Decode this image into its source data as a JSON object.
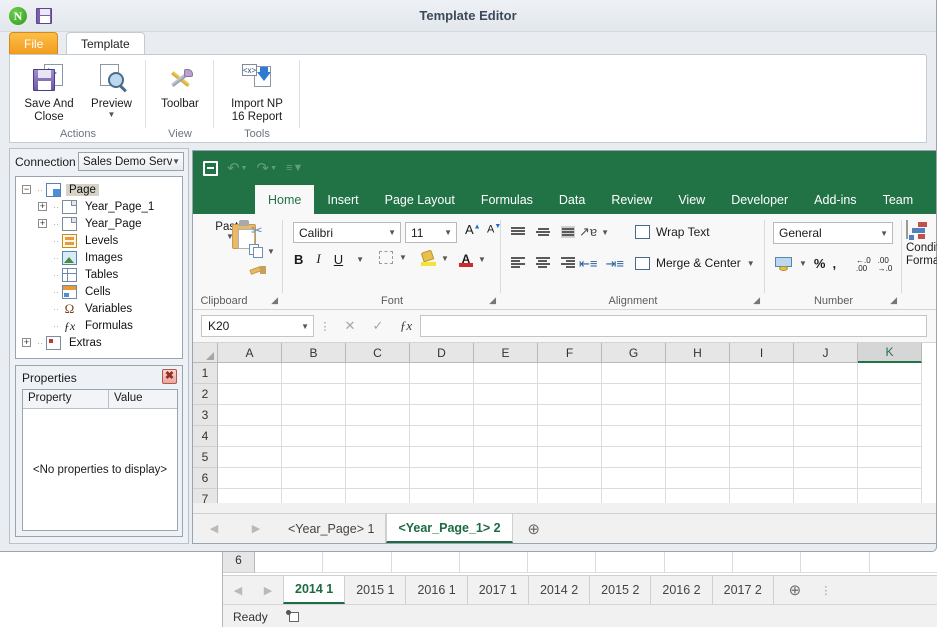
{
  "template_editor": {
    "title": "Template Editor",
    "logo_icon": "nprinting-logo-icon",
    "quick_save_icon": "save-icon",
    "tabs": [
      {
        "label": "File",
        "active": false
      },
      {
        "label": "Template",
        "active": true
      }
    ],
    "ribbon_groups": [
      {
        "name": "Actions",
        "label": "Actions",
        "buttons": [
          {
            "label_line1": "Save And",
            "label_line2": "Close",
            "icon": "save-and-close-icon",
            "has_caret": false
          },
          {
            "label_line1": "Preview",
            "label_line2": "",
            "icon": "preview-icon",
            "has_caret": true
          }
        ]
      },
      {
        "name": "View",
        "label": "View",
        "buttons": [
          {
            "label_line1": "Toolbar",
            "label_line2": "",
            "icon": "toolbar-icon",
            "has_caret": false
          }
        ]
      },
      {
        "name": "Tools",
        "label": "Tools",
        "buttons": [
          {
            "label_line1": "Import NP",
            "label_line2": "16 Report",
            "icon": "import-np-report-icon",
            "has_caret": false
          }
        ]
      }
    ],
    "connection": {
      "label": "Connection",
      "selected": "Sales Demo Server",
      "caret_icon": "chevron-down-icon"
    },
    "tree": [
      {
        "label": "Page",
        "icon": "page-icon",
        "depth": 0,
        "expander": "-",
        "selected": true
      },
      {
        "label": "Year_Page_1",
        "icon": "document-icon",
        "depth": 1,
        "expander": "+",
        "selected": false
      },
      {
        "label": "Year_Page",
        "icon": "document-icon",
        "depth": 1,
        "expander": "+",
        "selected": false
      },
      {
        "label": "Levels",
        "icon": "levels-icon",
        "depth": 1,
        "expander": "",
        "selected": false
      },
      {
        "label": "Images",
        "icon": "images-icon",
        "depth": 1,
        "expander": "",
        "selected": false
      },
      {
        "label": "Tables",
        "icon": "tables-icon",
        "depth": 1,
        "expander": "",
        "selected": false
      },
      {
        "label": "Cells",
        "icon": "cells-icon",
        "depth": 1,
        "expander": "",
        "selected": false
      },
      {
        "label": "Variables",
        "icon": "omega-icon",
        "depth": 1,
        "expander": "",
        "selected": false
      },
      {
        "label": "Formulas",
        "icon": "fx-icon",
        "depth": 1,
        "expander": "",
        "selected": false
      },
      {
        "label": "Extras",
        "icon": "extras-icon",
        "depth": 0,
        "expander": "+",
        "selected": false
      }
    ],
    "properties": {
      "title": "Properties",
      "close_icon": "close-icon",
      "columns": [
        "Property",
        "Value"
      ],
      "empty_text": "<No properties to display>"
    }
  },
  "excel": {
    "quick_access": {
      "save_icon": "save-icon",
      "undo_icon": "undo-icon",
      "redo_icon": "redo-icon",
      "customize_icon": "customize-qat-icon"
    },
    "ribbon_tabs": [
      {
        "label": "Home",
        "active": true
      },
      {
        "label": "Insert",
        "active": false
      },
      {
        "label": "Page Layout",
        "active": false
      },
      {
        "label": "Formulas",
        "active": false
      },
      {
        "label": "Data",
        "active": false
      },
      {
        "label": "Review",
        "active": false
      },
      {
        "label": "View",
        "active": false
      },
      {
        "label": "Developer",
        "active": false
      },
      {
        "label": "Add-ins",
        "active": false
      },
      {
        "label": "Team",
        "active": false
      }
    ],
    "groups": {
      "clipboard": {
        "label": "Clipboard",
        "paste_label": "Paste",
        "cut_icon": "cut-icon",
        "copy_icon": "copy-icon",
        "format_painter_icon": "format-painter-icon",
        "launcher_icon": "dialog-launcher-icon"
      },
      "font": {
        "label": "Font",
        "font_name": "Calibri",
        "font_size": "11",
        "grow_font_label": "A",
        "shrink_font_label": "A",
        "bold_label": "B",
        "italic_label": "I",
        "underline_label": "U",
        "borders_icon": "borders-icon",
        "fill_color_icon": "fill-color-icon",
        "font_color_icon": "font-color-icon",
        "launcher_icon": "dialog-launcher-icon"
      },
      "alignment": {
        "label": "Alignment",
        "orientation_icon": "orientation-icon",
        "wrap_text_label": "Wrap Text",
        "wrap_text_icon": "wrap-text-icon",
        "merge_center_label": "Merge & Center",
        "merge_center_icon": "merge-center-icon",
        "decrease_indent_icon": "decrease-indent-icon",
        "increase_indent_icon": "increase-indent-icon",
        "launcher_icon": "dialog-launcher-icon"
      },
      "number": {
        "label": "Number",
        "format": "General",
        "accounting_icon": "accounting-format-icon",
        "percent_label": "%",
        "comma_label": ",",
        "increase_decimal_icon": "increase-decimal-icon",
        "decrease_decimal_icon": "decrease-decimal-icon",
        "launcher_icon": "dialog-launcher-icon"
      },
      "styles": {
        "conditional_formatting_line1": "Conditi",
        "conditional_formatting_line2": "Formatt",
        "conditional_formatting_icon": "conditional-formatting-icon"
      }
    },
    "formula_bar": {
      "name_box": "K20",
      "name_box_caret_icon": "chevron-down-icon",
      "cancel_icon": "cancel-icon",
      "enter_icon": "enter-icon",
      "function_icon": "insert-function-icon",
      "formula_value": ""
    },
    "grid": {
      "columns": [
        "A",
        "B",
        "C",
        "D",
        "E",
        "F",
        "G",
        "H",
        "I",
        "J",
        "K"
      ],
      "selected_column": "K",
      "rows": [
        "1",
        "2",
        "3",
        "4",
        "5",
        "6",
        "7"
      ]
    },
    "sheet_tabs": {
      "prev_icon": "prev-sheet-icon",
      "next_icon": "next-sheet-icon",
      "add_icon": "add-sheet-icon",
      "tabs": [
        {
          "label": "<Year_Page> 1",
          "active": false
        },
        {
          "label": "<Year_Page_1> 2",
          "active": true
        }
      ]
    }
  },
  "background_excel": {
    "row_header": "6",
    "prev_icon": "prev-sheet-icon",
    "next_icon": "next-sheet-icon",
    "add_icon": "add-sheet-icon",
    "more_icon": "tab-overflow-icon",
    "tabs": [
      {
        "label": "2014 1",
        "active": true
      },
      {
        "label": "2015 1",
        "active": false
      },
      {
        "label": "2016 1",
        "active": false
      },
      {
        "label": "2017 1",
        "active": false
      },
      {
        "label": "2014 2",
        "active": false
      },
      {
        "label": "2015 2",
        "active": false
      },
      {
        "label": "2016 2",
        "active": false
      },
      {
        "label": "2017 2",
        "active": false
      }
    ],
    "status_text": "Ready",
    "status_icon": "macro-record-icon"
  },
  "colors": {
    "excel_green": "#217346",
    "file_tab_orange": "#f29a1c",
    "selected_tree_node": "#d6d2c8",
    "window_chrome": "#e9edf2"
  }
}
